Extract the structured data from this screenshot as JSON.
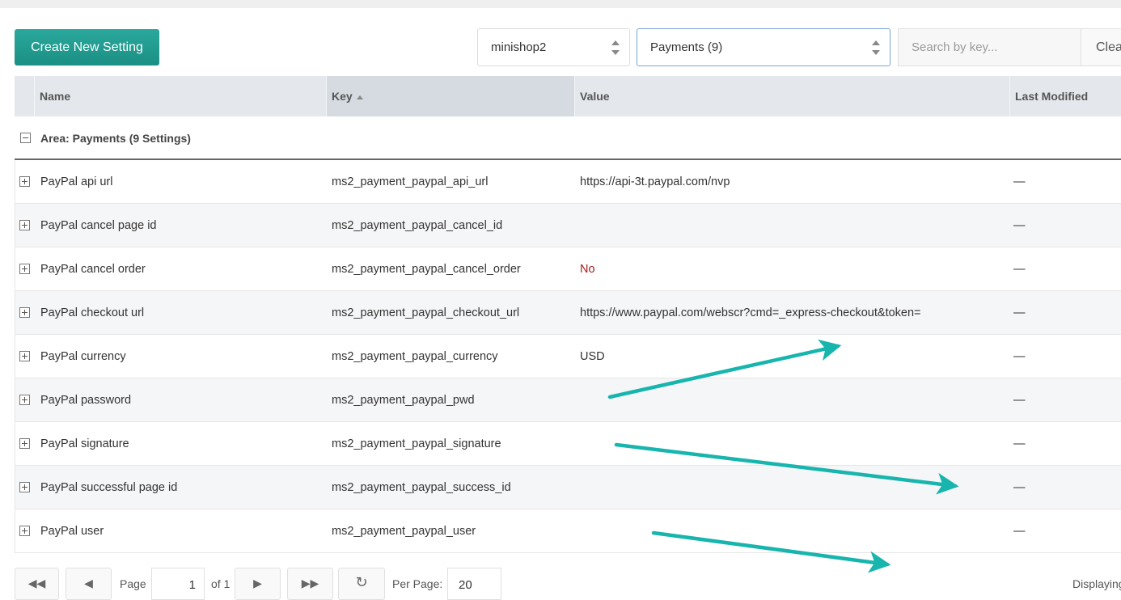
{
  "toolbar": {
    "create_label": "Create New Setting",
    "namespace_value": "minishop2",
    "area_value": "Payments (9)",
    "search_placeholder": "Search by key...",
    "clear_label": "Clear"
  },
  "columns": {
    "name": "Name",
    "key": "Key",
    "value": "Value",
    "modified": "Last Modified"
  },
  "group": {
    "label": "Area: Payments (9 Settings)"
  },
  "rows": [
    {
      "name": "PayPal api url",
      "key": "ms2_payment_paypal_api_url",
      "value": "https://api-3t.paypal.com/nvp",
      "modified": "—"
    },
    {
      "name": "PayPal cancel page id",
      "key": "ms2_payment_paypal_cancel_id",
      "value": "",
      "modified": "—"
    },
    {
      "name": "PayPal cancel order",
      "key": "ms2_payment_paypal_cancel_order",
      "value": "No",
      "modified": "—"
    },
    {
      "name": "PayPal checkout url",
      "key": "ms2_payment_paypal_checkout_url",
      "value": "https://www.paypal.com/webscr?cmd=_express-checkout&token=",
      "modified": "—"
    },
    {
      "name": "PayPal currency",
      "key": "ms2_payment_paypal_currency",
      "value": "USD",
      "modified": "—"
    },
    {
      "name": "PayPal password",
      "key": "ms2_payment_paypal_pwd",
      "value": "",
      "modified": "—"
    },
    {
      "name": "PayPal signature",
      "key": "ms2_payment_paypal_signature",
      "value": "",
      "modified": "—"
    },
    {
      "name": "PayPal successful page id",
      "key": "ms2_payment_paypal_success_id",
      "value": "",
      "modified": "—"
    },
    {
      "name": "PayPal user",
      "key": "ms2_payment_paypal_user",
      "value": "",
      "modified": "—"
    }
  ],
  "pager": {
    "page_label": "Page",
    "page_value": "1",
    "of_label": "of 1",
    "per_page_label": "Per Page:",
    "per_page_value": "20",
    "displaying_label": "Displaying"
  },
  "colors": {
    "accent": "#1b9c90",
    "annotation_arrow": "#17b5ad",
    "no_value": "#a41d1d"
  }
}
